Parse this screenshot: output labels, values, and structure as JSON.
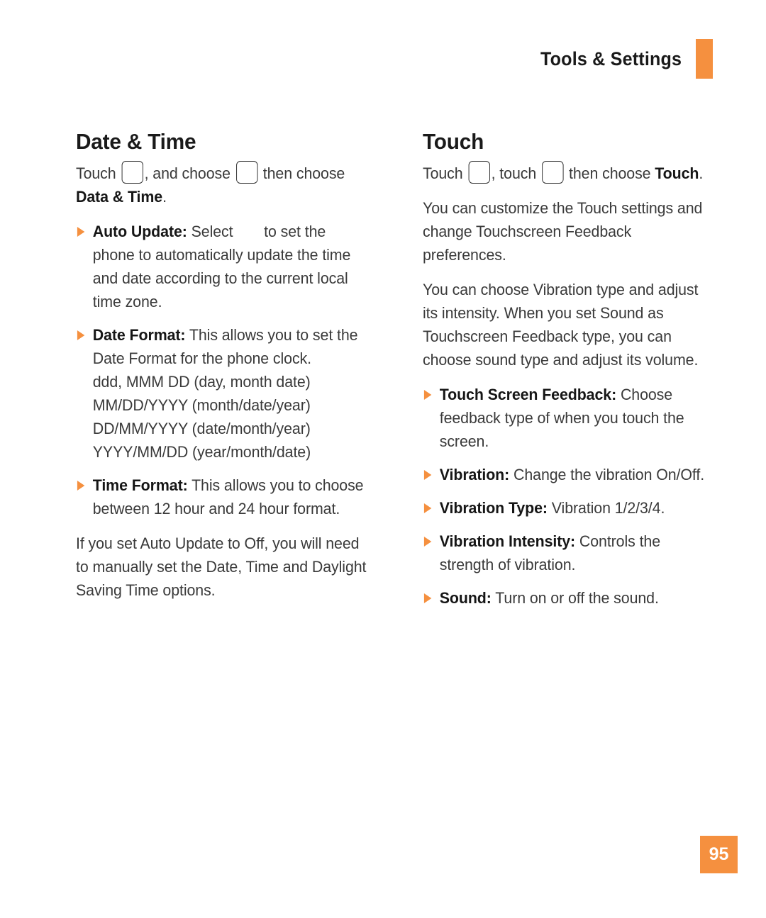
{
  "header": {
    "title": "Tools & Settings",
    "accent_color": "#F5903F"
  },
  "left_column": {
    "section_title": "Date & Time",
    "intro": {
      "part1": "Touch",
      "part2": ", and choose",
      "part3": "then choose",
      "bold_tail": "Data & Time",
      "period": "."
    },
    "bullets": [
      {
        "label": "Auto Update:",
        "text_before_icon": "Select",
        "text_after_icon": "to set the phone to automatically update the time and date according to the current local time zone."
      },
      {
        "label": "Date Format:",
        "text": "This allows you to set the Date Format for the phone clock.",
        "formats": [
          "ddd, MMM DD (day, month date)",
          "MM/DD/YYYY (month/date/year)",
          "DD/MM/YYYY (date/month/year)",
          "YYYY/MM/DD (year/month/date)"
        ]
      },
      {
        "label": "Time Format:",
        "text": "This allows you to choose between 12 hour and 24 hour format."
      }
    ],
    "closing_paragraph": "If you set Auto Update to Off, you will need to manually set the Date, Time and Daylight Saving Time options."
  },
  "right_column": {
    "section_title": "Touch",
    "intro": {
      "part1": "Touch",
      "part2": ", touch",
      "part3": "then choose",
      "bold_tail": "Touch",
      "period": "."
    },
    "paragraphs": [
      "You can customize the Touch settings and change Touchscreen Feedback preferences.",
      "You can choose Vibration type and adjust its intensity. When you set Sound as Touchscreen Feedback type, you can choose sound type and adjust its volume."
    ],
    "bullets": [
      {
        "label": "Touch Screen Feedback:",
        "text": "Choose feedback type of when you touch the screen."
      },
      {
        "label": "Vibration:",
        "text": "Change the vibration On/Off."
      },
      {
        "label": "Vibration Type:",
        "text": "Vibration 1/2/3/4."
      },
      {
        "label": "Vibration Intensity:",
        "text": "Controls the strength of vibration."
      },
      {
        "label": "Sound:",
        "text": "Turn on or off the sound."
      }
    ]
  },
  "footer": {
    "page_number": "95"
  }
}
